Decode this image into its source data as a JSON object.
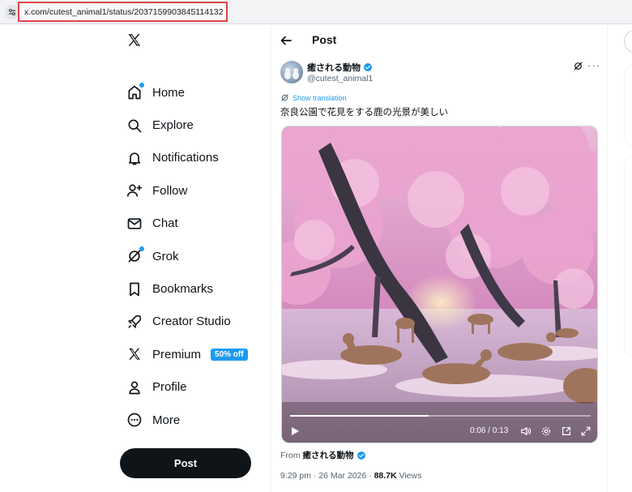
{
  "browser": {
    "url": "x.com/cutest_animal1/status/2037159903845114132"
  },
  "nav": {
    "items": [
      {
        "label": "Home",
        "icon": "home-icon",
        "dot": true
      },
      {
        "label": "Explore",
        "icon": "search-icon"
      },
      {
        "label": "Notifications",
        "icon": "bell-icon"
      },
      {
        "label": "Follow",
        "icon": "person-add-icon"
      },
      {
        "label": "Chat",
        "icon": "envelope-icon"
      },
      {
        "label": "Grok",
        "icon": "grok-icon",
        "dot": true
      },
      {
        "label": "Bookmarks",
        "icon": "bookmark-icon"
      },
      {
        "label": "Creator Studio",
        "icon": "rocket-icon"
      },
      {
        "label": "Premium",
        "icon": "x-logo-icon",
        "badge": "50% off"
      },
      {
        "label": "Profile",
        "icon": "person-icon"
      },
      {
        "label": "More",
        "icon": "more-circle-icon"
      }
    ],
    "post_button": "Post"
  },
  "header": {
    "title": "Post"
  },
  "tweet": {
    "display_name": "癒される動物",
    "handle": "@cutest_animal1",
    "translate_label": "Show translation",
    "text": "奈良公園で花見をする鹿の光景が美しい",
    "video": {
      "time": "0:06 / 0:13",
      "progress": 0.46
    },
    "from_label": "From",
    "from_name": "癒される動物",
    "timestamp": "9:29 pm · 26 Mar 2026 · ",
    "views_count": "88.7K",
    "views_label": " Views"
  },
  "colors": {
    "accent": "#1d9bf0",
    "text": "#0f1419",
    "muted": "#536471",
    "url_highlight": "#e0464b"
  }
}
